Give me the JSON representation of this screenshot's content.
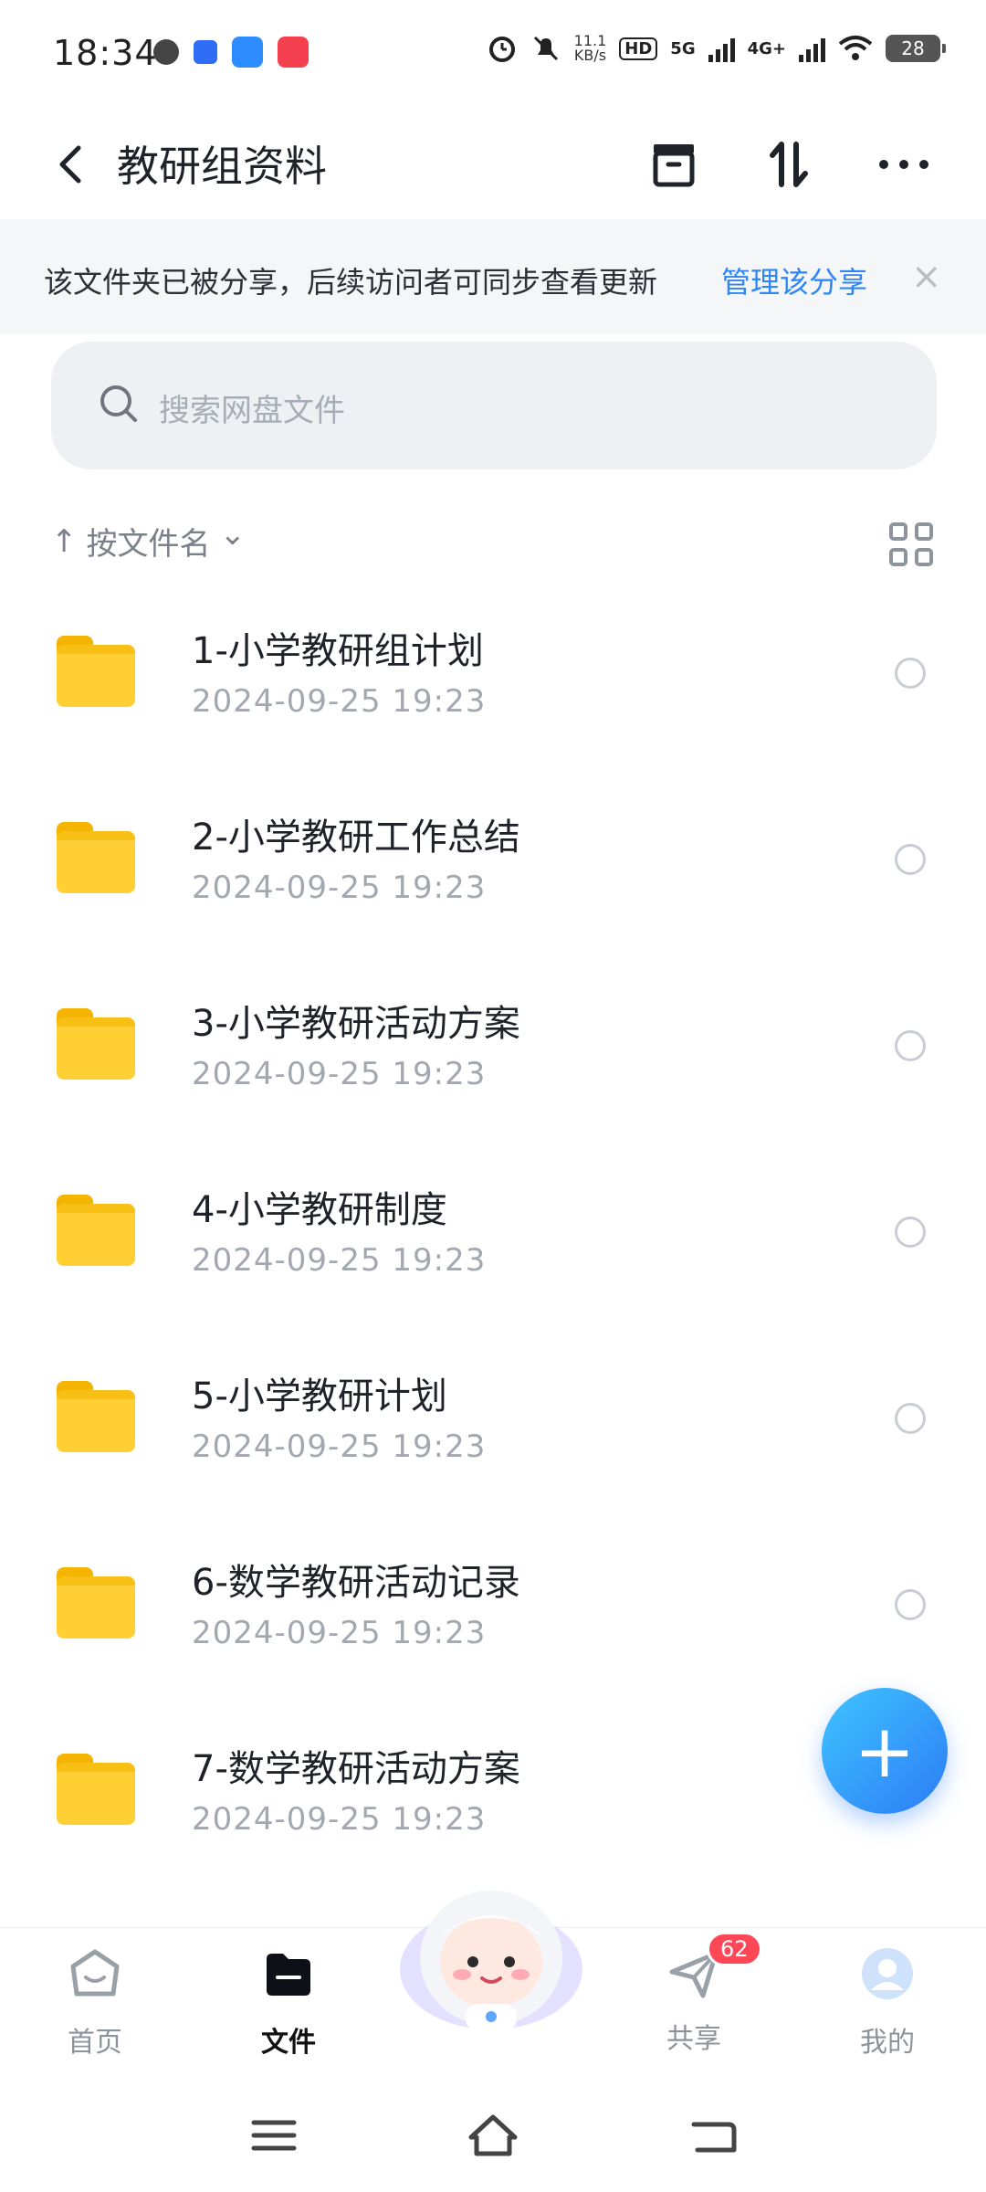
{
  "status_bar": {
    "time": "18:34",
    "net_speed_value": "11.1",
    "net_speed_unit": "KB/s",
    "hd_label": "HD",
    "network_5g": "5G",
    "network_4g": "4G+",
    "battery": "28"
  },
  "header": {
    "title": "教研组资料"
  },
  "share_banner": {
    "text": "该文件夹已被分享，后续访问者可同步查看更新",
    "link": "管理该分享",
    "close": "×"
  },
  "search": {
    "placeholder": "搜索网盘文件"
  },
  "sort": {
    "arrow": "↑",
    "label": "按文件名",
    "chevron": "⌄"
  },
  "files": [
    {
      "name": "1-小学教研组计划",
      "date": "2024-09-25  19:23"
    },
    {
      "name": "2-小学教研工作总结",
      "date": "2024-09-25  19:23"
    },
    {
      "name": "3-小学教研活动方案",
      "date": "2024-09-25  19:23"
    },
    {
      "name": "4-小学教研制度",
      "date": "2024-09-25  19:23"
    },
    {
      "name": "5-小学教研计划",
      "date": "2024-09-25  19:23"
    },
    {
      "name": "6-数学教研活动记录",
      "date": "2024-09-25  19:23"
    },
    {
      "name": "7-数学教研活动方案",
      "date": "2024-09-25  19:23"
    }
  ],
  "fab": {
    "icon": "+"
  },
  "bottom_nav": {
    "home": "首页",
    "files": "文件",
    "share": "共享",
    "share_badge": "62",
    "me": "我的"
  },
  "colors": {
    "accent": "#2f86f6",
    "folder": "#ffcf33",
    "badge": "#ff4757"
  }
}
